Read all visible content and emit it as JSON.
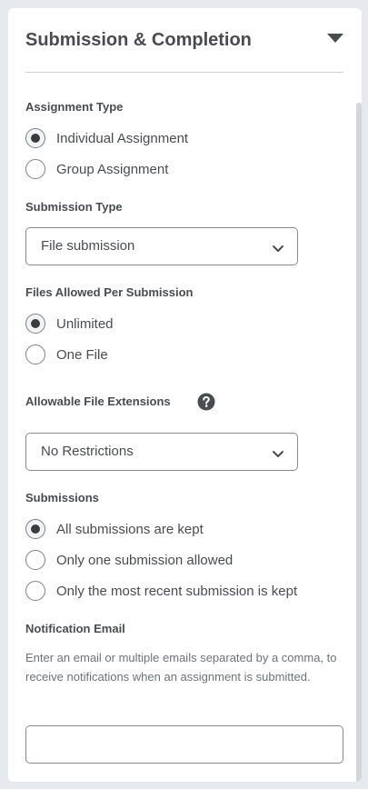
{
  "section": {
    "title": "Submission & Completion",
    "collapse_icon": "caret-down-icon"
  },
  "assignment_type": {
    "label": "Assignment Type",
    "options": [
      {
        "label": "Individual Assignment",
        "checked": true
      },
      {
        "label": "Group Assignment",
        "checked": false
      }
    ]
  },
  "submission_type": {
    "label": "Submission Type",
    "value": "File submission",
    "icon": "chevron-down-icon"
  },
  "files_allowed": {
    "label": "Files Allowed Per Submission",
    "options": [
      {
        "label": "Unlimited",
        "checked": true
      },
      {
        "label": "One File",
        "checked": false
      }
    ]
  },
  "file_extensions": {
    "label": "Allowable File Extensions",
    "help_icon": "help-circle-icon",
    "value": "No Restrictions",
    "icon": "chevron-down-icon"
  },
  "submissions": {
    "label": "Submissions",
    "options": [
      {
        "label": "All submissions are kept",
        "checked": true
      },
      {
        "label": "Only one submission allowed",
        "checked": false
      },
      {
        "label": "Only the most recent submission is kept",
        "checked": false
      }
    ]
  },
  "notification_email": {
    "label": "Notification Email",
    "help_text": "Enter an email or multiple emails separated by a comma, to receive notifications when an assignment is submitted.",
    "value": ""
  }
}
